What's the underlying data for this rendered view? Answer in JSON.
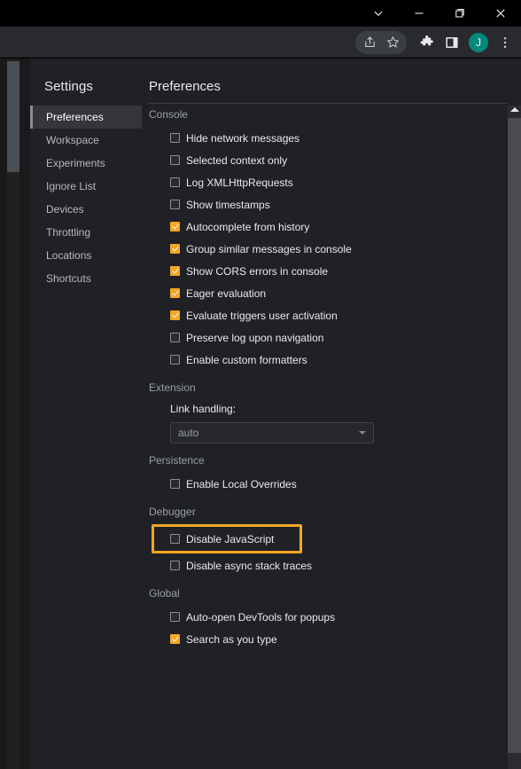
{
  "window_controls": [
    {
      "name": "chevron-down-icon",
      "label": "Search tabs"
    },
    {
      "name": "minimize-icon",
      "label": "Minimize"
    },
    {
      "name": "restore-icon",
      "label": "Restore"
    },
    {
      "name": "close-icon",
      "label": "Close"
    }
  ],
  "browser_toolbar": {
    "omnibox_icons": [
      {
        "name": "share-icon",
        "label": "Share this page"
      },
      {
        "name": "star-icon",
        "label": "Bookmark this tab"
      }
    ],
    "icons": [
      {
        "name": "extensions-puzzle-icon",
        "label": "Extensions"
      },
      {
        "name": "side-panel-icon",
        "label": "Side panel"
      }
    ],
    "avatar_initial": "J",
    "menu": {
      "name": "three-dot-menu-icon",
      "label": "Customize and control"
    }
  },
  "devtools": {
    "close_label": "×",
    "sidebar": {
      "title": "Settings",
      "items": [
        {
          "label": "Preferences",
          "selected": true
        },
        {
          "label": "Workspace",
          "selected": false
        },
        {
          "label": "Experiments",
          "selected": false
        },
        {
          "label": "Ignore List",
          "selected": false
        },
        {
          "label": "Devices",
          "selected": false
        },
        {
          "label": "Throttling",
          "selected": false
        },
        {
          "label": "Locations",
          "selected": false
        },
        {
          "label": "Shortcuts",
          "selected": false
        }
      ]
    },
    "content": {
      "title": "Preferences",
      "sections": [
        {
          "name": "console",
          "title": "Console",
          "type": "checkboxes",
          "items": [
            {
              "label": "Hide network messages",
              "checked": false
            },
            {
              "label": "Selected context only",
              "checked": false
            },
            {
              "label": "Log XMLHttpRequests",
              "checked": false
            },
            {
              "label": "Show timestamps",
              "checked": false
            },
            {
              "label": "Autocomplete from history",
              "checked": true
            },
            {
              "label": "Group similar messages in console",
              "checked": true
            },
            {
              "label": "Show CORS errors in console",
              "checked": true
            },
            {
              "label": "Eager evaluation",
              "checked": true
            },
            {
              "label": "Evaluate triggers user activation",
              "checked": true
            },
            {
              "label": "Preserve log upon navigation",
              "checked": false
            },
            {
              "label": "Enable custom formatters",
              "checked": false
            }
          ]
        },
        {
          "name": "extension",
          "title": "Extension",
          "type": "select",
          "field_label": "Link handling:",
          "select_value": "auto"
        },
        {
          "name": "persistence",
          "title": "Persistence",
          "type": "checkboxes",
          "items": [
            {
              "label": "Enable Local Overrides",
              "checked": false
            }
          ]
        },
        {
          "name": "debugger",
          "title": "Debugger",
          "type": "checkboxes",
          "items": [
            {
              "label": "Disable JavaScript",
              "checked": false,
              "highlighted": true
            },
            {
              "label": "Disable async stack traces",
              "checked": false
            }
          ]
        },
        {
          "name": "global",
          "title": "Global",
          "type": "checkboxes",
          "items": [
            {
              "label": "Auto-open DevTools for popups",
              "checked": false
            },
            {
              "label": "Search as you type",
              "checked": true
            }
          ]
        }
      ]
    }
  },
  "colors": {
    "accent_orange": "#f5a623",
    "avatar_teal": "#00897b",
    "panel_bg": "#202124",
    "selected_bg": "#35363a",
    "section_title": "#9aa0a6",
    "text": "#e8eaed"
  }
}
